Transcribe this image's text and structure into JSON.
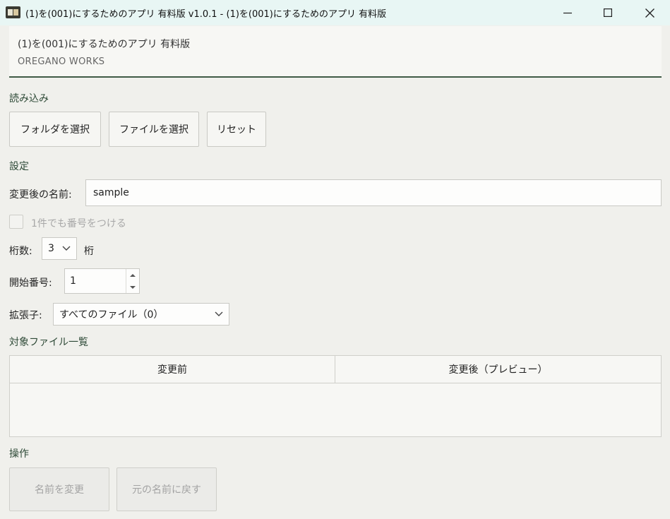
{
  "window": {
    "title": "(1)を(001)にするためのアプリ 有料版 v1.0.1 - (1)を(001)にするためのアプリ 有料版"
  },
  "header": {
    "app_name": "(1)を(001)にするためのアプリ 有料版",
    "publisher": "OREGANO WORKS"
  },
  "load": {
    "section_label": "読み込み",
    "select_folder": "フォルダを選択",
    "select_file": "ファイルを選択",
    "reset": "リセット"
  },
  "settings": {
    "section_label": "設定",
    "new_name_label": "変更後の名前:",
    "new_name_value": "sample",
    "number_single_label": "1件でも番号をつける",
    "number_single_checked": false,
    "digits_label": "桁数:",
    "digits_value": "3",
    "digits_unit": "桁",
    "start_label": "開始番号:",
    "start_value": "1",
    "ext_label": "拡張子:",
    "ext_value": "すべてのファイル（0）"
  },
  "files": {
    "section_label": "対象ファイル一覧",
    "columns": [
      "変更前",
      "変更後（プレビュー）"
    ],
    "rows": []
  },
  "actions": {
    "section_label": "操作",
    "rename": "名前を変更",
    "restore": "元の名前に戻す"
  }
}
